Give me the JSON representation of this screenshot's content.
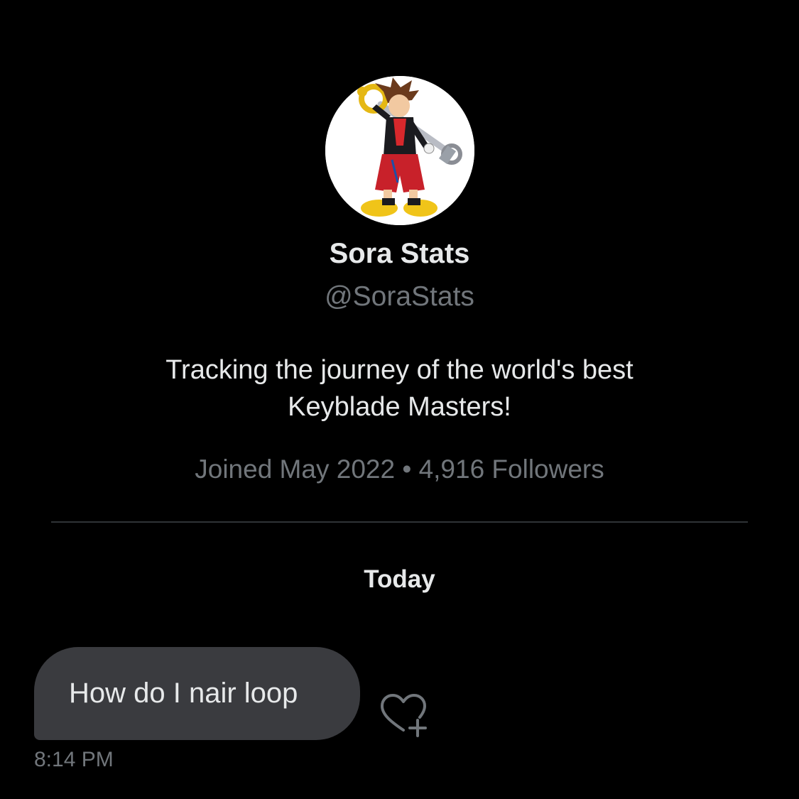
{
  "profile": {
    "display_name": "Sora Stats",
    "handle": "@SoraStats",
    "bio_line1": "Tracking the journey of the world's best",
    "bio_line2": "Keyblade Masters!",
    "meta": "Joined May 2022 • 4,916 Followers"
  },
  "conversation": {
    "date_separator": "Today",
    "messages": [
      {
        "text": "How do I nair loop",
        "time": "8:14 PM",
        "reaction_icon": "heart-plus-icon"
      }
    ]
  },
  "colors": {
    "background": "#000000",
    "primary_text": "#e7e9ea",
    "secondary_text": "#71767b",
    "bubble": "#3a3b3f",
    "divider": "#2f3336"
  }
}
